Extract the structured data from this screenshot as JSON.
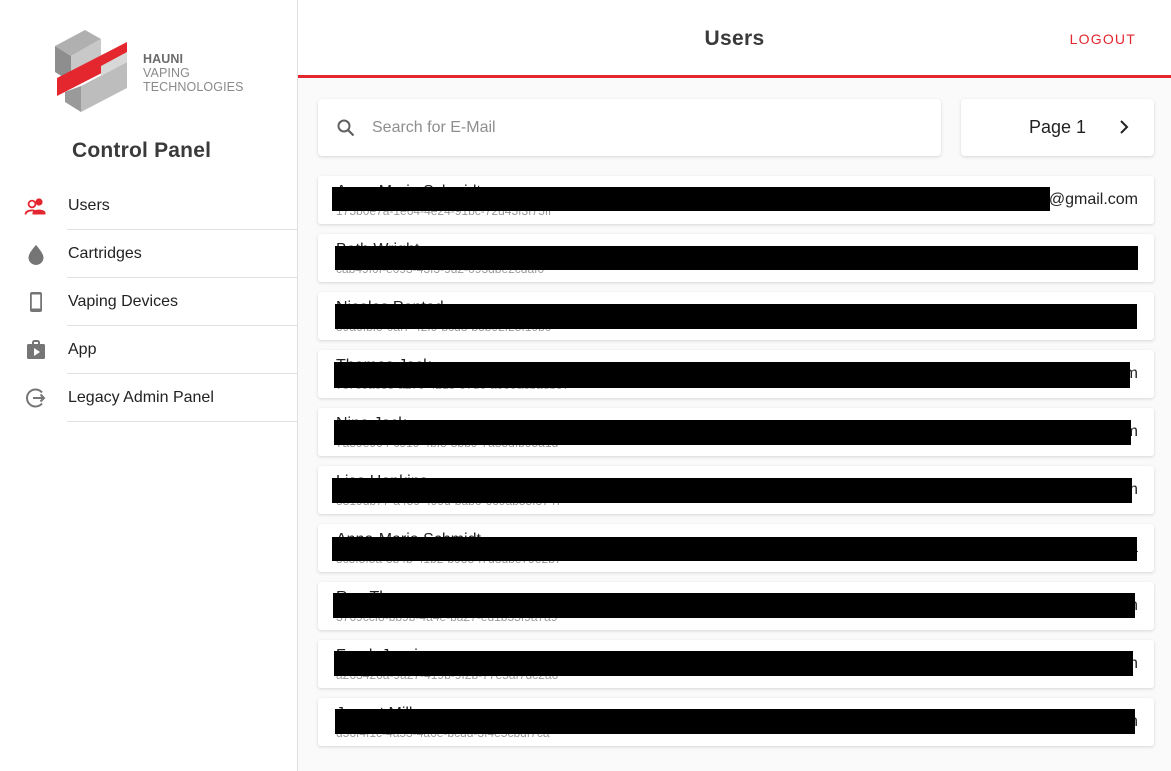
{
  "brand": {
    "line1": "HAUNI",
    "line2": "VAPING",
    "line3": "TECHNOLOGIES",
    "accent": "#e4262f"
  },
  "sidebar": {
    "title": "Control Panel",
    "items": [
      {
        "label": "Users",
        "icon": "users-icon",
        "active": true
      },
      {
        "label": "Cartridges",
        "icon": "drop-icon"
      },
      {
        "label": "Vaping Devices",
        "icon": "phone-icon"
      },
      {
        "label": "App",
        "icon": "shop-bag-icon"
      },
      {
        "label": "Legacy Admin Panel",
        "icon": "logout-circle-icon"
      }
    ]
  },
  "header": {
    "title": "Users",
    "logout_label": "LOGOUT"
  },
  "search": {
    "placeholder": "Search for E-Mail",
    "value": ""
  },
  "pager": {
    "label": "Page 1"
  },
  "users": [
    {
      "name": "Anna-Marie Schmidt",
      "id": "175b0e7a-1e64-4e24-91bc-72d45f3f75ff",
      "email": "@gmail.com"
    },
    {
      "name": "Beth Wright",
      "id": "cab49f0f-e093-43f3-9d2-093dbe2cdaf0",
      "email": ""
    },
    {
      "name": "Nicolas Pentad",
      "id": "39a6fbf3-0af7-42f9-bcd8-b8b92f25f19bc",
      "email": ""
    },
    {
      "name": "Thomas Jack",
      "id": "7c7c0ac83-a270-4219-97d0-a999acbaeb97",
      "email": "m"
    },
    {
      "name": "Nina Jack",
      "id": "7a59e964-c919-4bf3-8bb9-7a85dfb95a1d",
      "email": "m"
    },
    {
      "name": "Lisa Hopkins",
      "id": "3319db77-a459-499d-bab6-669ab55f3747",
      "email": "m"
    },
    {
      "name": "Anna-Marie Schmidt",
      "id": "3c8f5f5a-3b4b-41b2-b938-f7d8dbe79e2b7",
      "email": "a"
    },
    {
      "name": "Ron Thomas",
      "id": "3769ccf8-bb9b-4a4e-ba27-ed1b55f9a7a9",
      "email": "m"
    },
    {
      "name": "Frank Jessie",
      "id": "a263426a-9a27-419b-9f2b-77e5af7dc2a6",
      "email": "m"
    },
    {
      "name": "Jannet Miller",
      "id": "d56f4f1c-4a53-4a6e-bcdd-3f4e5cbdf7ca",
      "email": "m"
    }
  ]
}
